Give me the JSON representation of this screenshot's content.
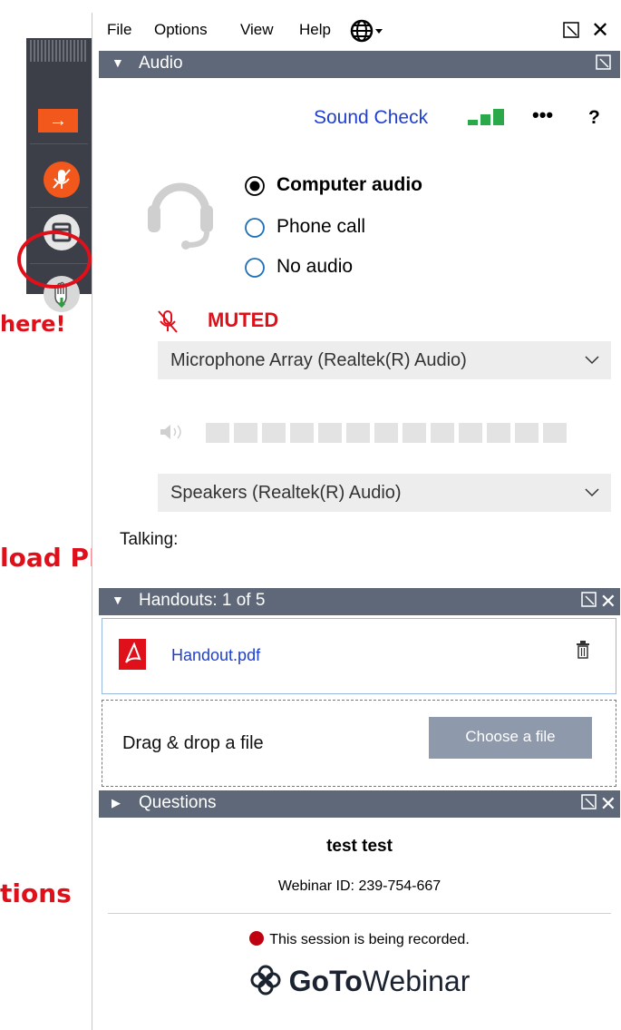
{
  "annotations": {
    "raise_hand": "here!",
    "upload": "load PDF of Slides here!",
    "questions": "tions"
  },
  "menu": {
    "file": "File",
    "options": "Options",
    "view": "View",
    "help": "Help"
  },
  "audio": {
    "title": "Audio",
    "sound_check": "Sound Check",
    "more": "•••",
    "help": "?",
    "options": [
      "Computer audio",
      "Phone call",
      "No audio"
    ],
    "selected": "Computer audio",
    "muted": "MUTED",
    "microphone": "Microphone Array (Realtek(R) Audio)",
    "speakers": "Speakers (Realtek(R) Audio)",
    "talking": "Talking:"
  },
  "handouts": {
    "title": "Handouts: 1 of 5",
    "file": "Handout.pdf",
    "drop_text": "Drag & drop a file",
    "choose_button": "Choose a file"
  },
  "questions": {
    "title": "Questions",
    "organizer": "test test",
    "webinar_id": "Webinar ID: 239-754-667",
    "recording": "This session is being recorded.",
    "brand_bold": "GoTo",
    "brand_light": "Webinar"
  },
  "colors": {
    "header": "#5e6878",
    "accent": "#e0101a",
    "link": "#1f3fd1",
    "toolbar": "#3c3e48",
    "orange": "#f2581c"
  },
  "icons": [
    "globe-icon",
    "headset-icon",
    "mic-muted-icon",
    "speaker-icon",
    "pdf-icon",
    "trash-icon",
    "hand-icon",
    "window-icon"
  ]
}
